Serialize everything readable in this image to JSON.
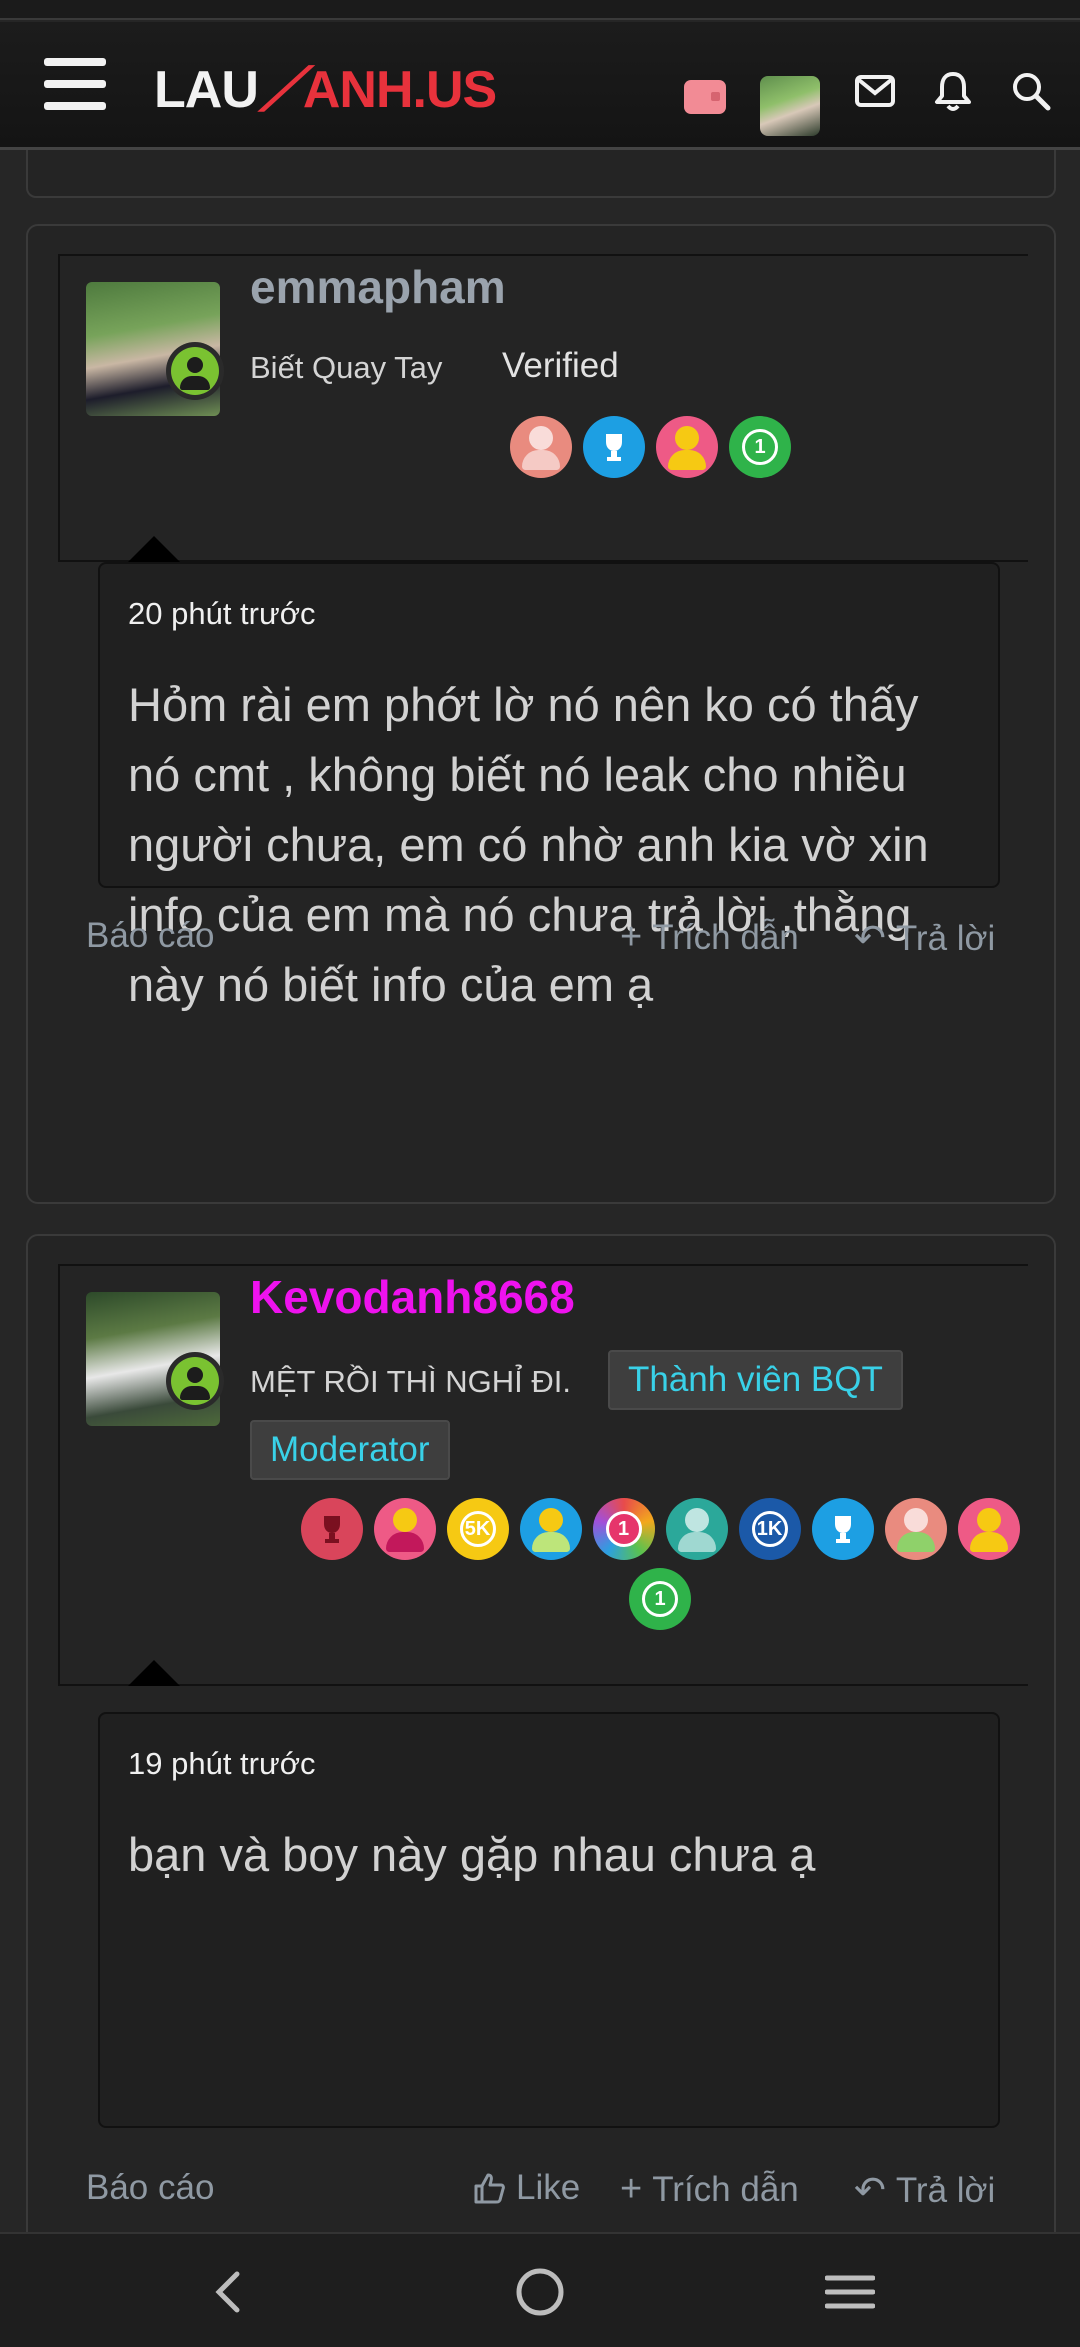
{
  "header": {
    "logo": {
      "part1": "LAU",
      "part2": "ANH.US"
    },
    "icons": [
      "menu-icon",
      "wallet-icon",
      "avatar",
      "mail-icon",
      "bell-icon",
      "search-icon"
    ]
  },
  "posts": [
    {
      "username": "emmapham",
      "username_color": "#9aa3ad",
      "user_title": "Biết Quay Tay",
      "banner": "Verified",
      "trophies": [
        "green-person",
        "blue-trophy",
        "pink-person",
        "green-1"
      ],
      "time": "20 phút trước",
      "message": "Hỏm rài em phớt lờ nó nên ko có thấy nó cmt , không biết nó leak cho nhiều người chưa, em có nhờ anh kia vờ xin info của em mà nó chưa trả lời ,thằng này nó biết info của em ạ",
      "actions": {
        "report": "Báo cáo",
        "quote": "Trích dẫn",
        "reply": "Trả lời"
      }
    },
    {
      "username": "Kevodanh8668",
      "username_color": "#ee12ee",
      "user_title": "MỆT RỒI THÌ NGHỈ ĐI.",
      "banners": [
        "Thành viên BQT",
        "Moderator"
      ],
      "trophies": [
        "red-trophy",
        "pink-person",
        "yellow-5K",
        "blue-person",
        "star-1",
        "teal-person",
        "navy-1K",
        "blue-trophy",
        "salmon-person",
        "pink-person",
        "green-1"
      ],
      "time": "19 phút trước",
      "message": "bạn và boy này gặp nhau chưa ạ",
      "actions": {
        "report": "Báo cáo",
        "like": "Like",
        "quote": "Trích dẫn",
        "reply": "Trả lời"
      }
    }
  ],
  "trophy_labels": {
    "fivek": "5K",
    "onek": "1K",
    "one": "1"
  },
  "nav": [
    "back-icon",
    "home-icon",
    "recents-icon"
  ]
}
